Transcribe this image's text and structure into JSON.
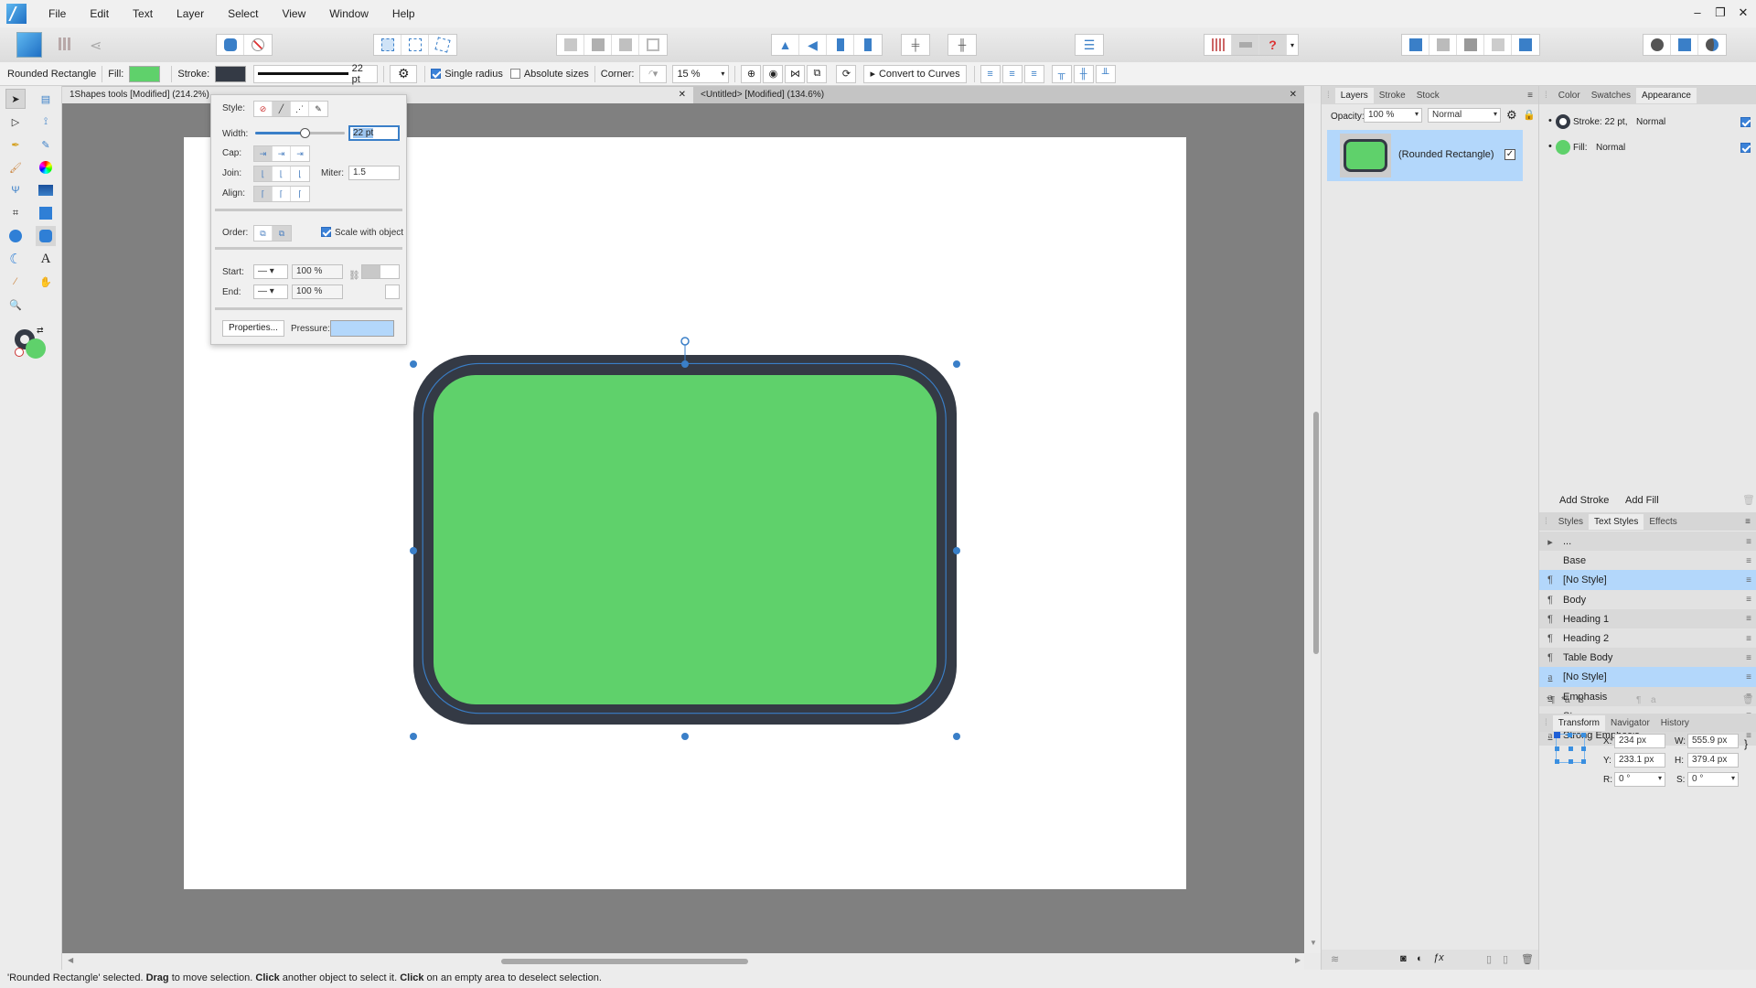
{
  "app": {
    "name": "Affinity Designer"
  },
  "menu": [
    "File",
    "Edit",
    "Text",
    "Layer",
    "Select",
    "View",
    "Window",
    "Help"
  ],
  "window_controls": {
    "minimize": "–",
    "restore": "❐",
    "close": "✕"
  },
  "context_toolbar": {
    "object_type": "Rounded Rectangle",
    "fill_label": "Fill:",
    "fill_color": "#5fd16b",
    "stroke_label": "Stroke:",
    "stroke_color": "#343a45",
    "stroke_width": "22 pt",
    "single_radius": {
      "label": "Single radius",
      "checked": true
    },
    "absolute_sizes": {
      "label": "Absolute sizes",
      "checked": false
    },
    "corner_label": "Corner:",
    "corner_value": "15 %",
    "convert_to_curves": "Convert to Curves"
  },
  "doc_tabs": [
    {
      "title": "1Shapes tools [Modified] (214.2%)",
      "active": true
    },
    {
      "title": "<Untitled> [Modified] (134.6%)",
      "active": false
    }
  ],
  "stroke_popover": {
    "style_label": "Style:",
    "width_label": "Width:",
    "width_value": "22 pt",
    "width_fraction": 0.55,
    "cap_label": "Cap:",
    "join_label": "Join:",
    "miter_label": "Miter:",
    "miter_value": "1.5",
    "align_label": "Align:",
    "order_label": "Order:",
    "scale_with_object": {
      "label": "Scale with object",
      "checked": true
    },
    "start_label": "Start:",
    "start_pct": "100 %",
    "end_label": "End:",
    "end_pct": "100 %",
    "properties_button": "Properties...",
    "pressure_label": "Pressure:"
  },
  "layers_panel": {
    "tabs": [
      "Layers",
      "Stroke",
      "Stock"
    ],
    "active_tab": "Layers",
    "opacity_label": "Opacity:",
    "opacity_value": "100 %",
    "blend_mode": "Normal",
    "layers": [
      {
        "name": "(Rounded Rectangle)",
        "visible": true,
        "selected": true
      }
    ]
  },
  "appearance_panel": {
    "tabs": [
      "Color",
      "Swatches",
      "Appearance"
    ],
    "active_tab": "Appearance",
    "items": [
      {
        "label": "Stroke: 22 pt,",
        "mode": "Normal",
        "enabled": true,
        "type": "stroke"
      },
      {
        "label": "Fill:",
        "mode": "Normal",
        "enabled": true,
        "type": "fill"
      }
    ],
    "add_stroke": "Add Stroke",
    "add_fill": "Add Fill"
  },
  "styles_panel": {
    "tabs": [
      "Styles",
      "Text Styles",
      "Effects"
    ],
    "active_tab": "Text Styles",
    "rows": [
      {
        "glyph": "▸",
        "name": "...",
        "selected": false
      },
      {
        "glyph": "",
        "name": "Base",
        "selected": false
      },
      {
        "glyph": "¶",
        "name": "[No Style]",
        "selected": true
      },
      {
        "glyph": "¶",
        "name": "Body",
        "selected": false
      },
      {
        "glyph": "¶",
        "name": "Heading 1",
        "selected": false
      },
      {
        "glyph": "¶",
        "name": "Heading 2",
        "selected": false
      },
      {
        "glyph": "¶",
        "name": "Table Body",
        "selected": false
      },
      {
        "glyph": "a",
        "name": "[No Style]",
        "selected": true
      },
      {
        "glyph": "a",
        "name": "Emphasis",
        "selected": false
      },
      {
        "glyph": "a",
        "name": "Strong",
        "selected": false
      },
      {
        "glyph": "a",
        "name": "Strong Emphasis",
        "selected": false
      }
    ]
  },
  "transform_panel": {
    "tabs": [
      "Transform",
      "Navigator",
      "History"
    ],
    "active_tab": "Transform",
    "x_label": "X:",
    "x": "234 px",
    "y_label": "Y:",
    "y": "233.1 px",
    "w_label": "W:",
    "w": "555.9 px",
    "h_label": "H:",
    "h": "379.4 px",
    "r_label": "R:",
    "r": "0 °",
    "s_label": "S:",
    "s": "0 °"
  },
  "status": {
    "parts": [
      {
        "text": "'Rounded Rectangle' selected. ",
        "bold": false
      },
      {
        "text": "Drag",
        "bold": true
      },
      {
        "text": " to move selection. ",
        "bold": false
      },
      {
        "text": "Click",
        "bold": true
      },
      {
        "text": " another object to select it. ",
        "bold": false
      },
      {
        "text": "Click",
        "bold": true
      },
      {
        "text": " on an empty area to deselect selection.",
        "bold": false
      }
    ]
  },
  "colors": {
    "accent": "#3b82d8",
    "selection": "#b3d7fb",
    "fill_green": "#5fd16b",
    "stroke_dark": "#343a45"
  }
}
